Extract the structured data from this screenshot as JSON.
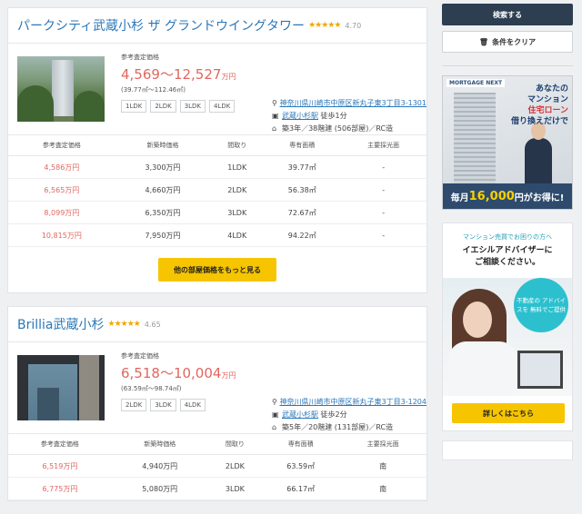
{
  "properties": [
    {
      "name": "パークシティ武蔵小杉 ザ グランドウイングタワー",
      "stars": "★★★★★",
      "rating": "4.70",
      "price_label": "参考査定価格",
      "price_range": "4,569〜12,527",
      "price_unit": "万円",
      "area_range": "(39.77㎡〜112.46㎡)",
      "layouts": [
        "1LDK",
        "2LDK",
        "3LDK",
        "4LDK"
      ],
      "address": "神奈川県川崎市中原区新丸子東3丁目3-1301",
      "station": "武蔵小杉駅",
      "walk": "徒歩1分",
      "building": "築3年／38階建 (506部屋)／RC造",
      "rows": [
        {
          "ref": "4,586万円",
          "new": "3,300万円",
          "layout": "1LDK",
          "area": "39.77㎡",
          "light": "-"
        },
        {
          "ref": "6,565万円",
          "new": "4,660万円",
          "layout": "2LDK",
          "area": "56.38㎡",
          "light": "-"
        },
        {
          "ref": "8,099万円",
          "new": "6,350万円",
          "layout": "3LDK",
          "area": "72.67㎡",
          "light": "-"
        },
        {
          "ref": "10,815万円",
          "new": "7,950万円",
          "layout": "4LDK",
          "area": "94.22㎡",
          "light": "-"
        }
      ],
      "more_label": "他の部屋価格をもっと見る"
    },
    {
      "name": "Brillia武蔵小杉",
      "stars": "★★★★★",
      "rating": "4.65",
      "price_label": "参考査定価格",
      "price_range": "6,518〜10,004",
      "price_unit": "万円",
      "area_range": "(63.59㎡〜98.74㎡)",
      "layouts": [
        "2LDK",
        "3LDK",
        "4LDK"
      ],
      "address": "神奈川県川崎市中原区新丸子東3丁目3-1204",
      "station": "武蔵小杉駅",
      "walk": "徒歩2分",
      "building": "築5年／20階建 (131部屋)／RC造",
      "rows": [
        {
          "ref": "6,519万円",
          "new": "4,940万円",
          "layout": "2LDK",
          "area": "63.59㎡",
          "light": "南"
        },
        {
          "ref": "6,775万円",
          "new": "5,080万円",
          "layout": "3LDK",
          "area": "66.17㎡",
          "light": "南"
        }
      ]
    }
  ],
  "table_headers": [
    "参考査定価格",
    "新築時価格",
    "間取り",
    "専有面積",
    "主要採光面"
  ],
  "sidebar": {
    "search_label": "検索する",
    "clear_label": "条件をクリア",
    "ad1": {
      "brand": "MORTGAGE NEXT",
      "copy_lines": [
        "あなたの",
        "マンション",
        "住宅ローン",
        "借り換えだけで"
      ],
      "bottom_prefix": "毎月",
      "bottom_amount": "16,000",
      "bottom_suffix": "円がお得に!"
    },
    "ad2": {
      "line1": "マンション売買でお困りの方へ",
      "line2": "イエシルアドバイザーに",
      "line3": "ご相談ください。",
      "bubble": "不動産の アドバイスを 無料でご提供",
      "button": "詳しくはこちら"
    }
  },
  "colors": {
    "accent_red": "#e0675f",
    "link_blue": "#2a77b8",
    "cta_yellow": "#f6c500",
    "dark_navy": "#2c3e50"
  }
}
